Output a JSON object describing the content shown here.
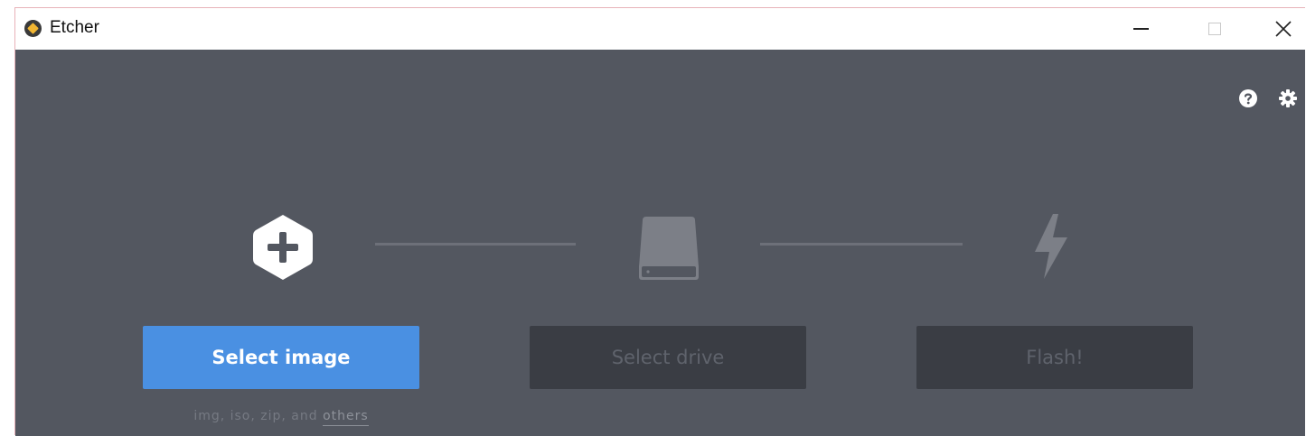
{
  "window": {
    "title": "Etcher",
    "controls": [
      "minimize",
      "maximize",
      "close"
    ]
  },
  "toolbar": {
    "help_icon": "help-circle-icon",
    "settings_icon": "gear-icon"
  },
  "steps": [
    {
      "icon": "plus-hexagon-icon",
      "button_label": "Select image",
      "enabled": true
    },
    {
      "icon": "drive-icon",
      "button_label": "Select drive",
      "enabled": false
    },
    {
      "icon": "lightning-icon",
      "button_label": "Flash!",
      "enabled": false
    }
  ],
  "formats": {
    "prefix": "img, iso, zip, and ",
    "link": "others"
  },
  "colors": {
    "background": "#535760",
    "accent": "#4a90e2",
    "disabled_button": "#3a3d44"
  }
}
